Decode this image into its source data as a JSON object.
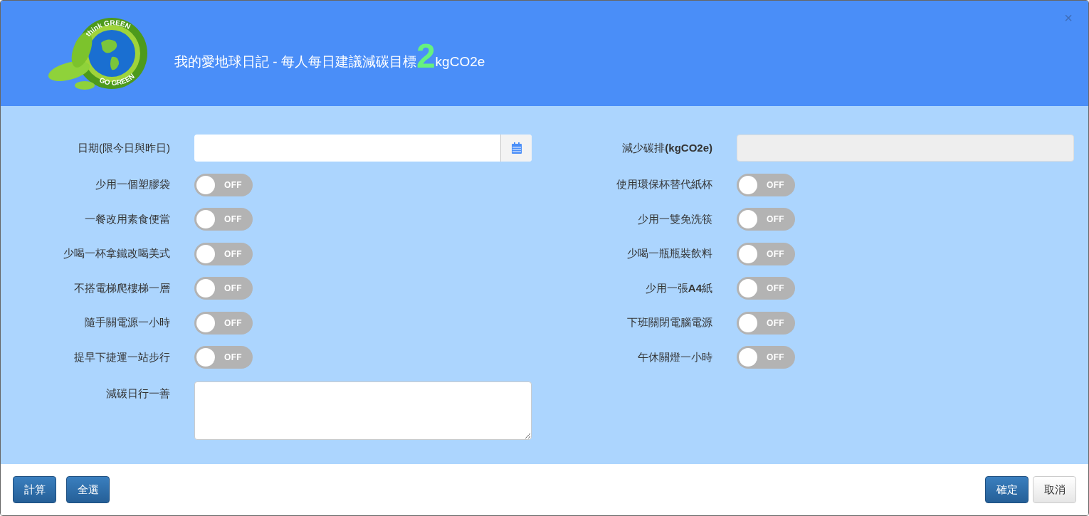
{
  "header": {
    "logo": {
      "top_text": "think GREEN",
      "bottom_text": "GO GREEN"
    },
    "title": "我的愛地球日記 - 每人每日建議減碳目標",
    "target": "2",
    "unit": "kgCO2e",
    "close": "×"
  },
  "date": {
    "label": "日期(限今日與昨日)"
  },
  "reduction": {
    "label": "減少碳排**(kgCO2e)**"
  },
  "left_items": [
    {
      "label": "少用一個塑膠袋",
      "on": false,
      "state_text": "OFF"
    },
    {
      "label": "一餐改用素食便當",
      "on": false,
      "state_text": "OFF"
    },
    {
      "label": "少喝一杯拿鐵改喝美式",
      "on": false,
      "state_text": "OFF"
    },
    {
      "label": "不搭電梯爬樓梯一層",
      "on": false,
      "state_text": "OFF"
    },
    {
      "label": "隨手關電源一小時",
      "on": false,
      "state_text": "OFF"
    },
    {
      "label": "提早下捷運一站步行",
      "on": false,
      "state_text": "OFF"
    }
  ],
  "right_items": [
    {
      "label": "使用環保杯替代紙杯",
      "on": false,
      "state_text": "OFF"
    },
    {
      "label": "少用一雙免洗筷",
      "on": false,
      "state_text": "OFF"
    },
    {
      "label": "少喝一瓶瓶裝飲料",
      "on": false,
      "state_text": "OFF"
    },
    {
      "label": "少用一張**A4**紙",
      "on": false,
      "state_text": "OFF"
    },
    {
      "label": "下班關閉電腦電源",
      "on": false,
      "state_text": "OFF"
    },
    {
      "label": "午休關燈一小時",
      "on": false,
      "state_text": "OFF"
    }
  ],
  "good_deed": {
    "label": "減碳日行一善"
  },
  "footer": {
    "left_buttons": [
      "計算",
      "全選"
    ],
    "confirm": "確定",
    "cancel": "取消"
  }
}
